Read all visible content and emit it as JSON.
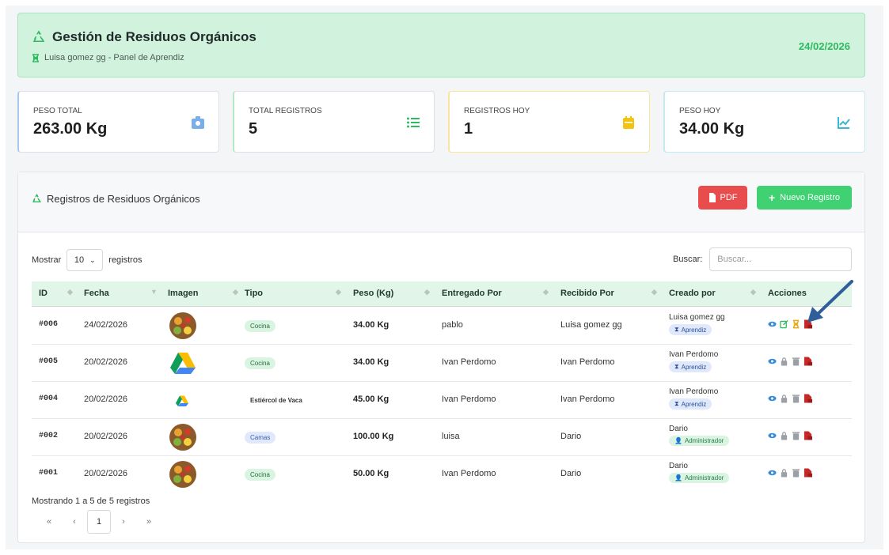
{
  "header": {
    "title": "Gestión de Residuos Orgánicos",
    "subtitle": "Luisa gomez gg - Panel de Aprendiz",
    "date": "24/02/2026"
  },
  "stats": [
    {
      "label": "PESO TOTAL",
      "value": "263.00 Kg",
      "icon": "weight-icon",
      "color": "#4a90e2"
    },
    {
      "label": "TOTAL REGISTROS",
      "value": "5",
      "icon": "list-icon",
      "color": "#2dbb5f"
    },
    {
      "label": "REGISTROS HOY",
      "value": "1",
      "icon": "calendar-icon",
      "color": "#f2c311"
    },
    {
      "label": "PESO HOY",
      "value": "34.00 Kg",
      "icon": "chart-line-icon",
      "color": "#3ab7d4"
    }
  ],
  "panel": {
    "title": "Registros de Residuos Orgánicos",
    "pdf_label": "PDF",
    "new_label": "Nuevo Registro"
  },
  "controls": {
    "show_label": "Mostrar",
    "show_value": "10",
    "show_suffix": "registros",
    "search_label": "Buscar:",
    "search_placeholder": "Buscar..."
  },
  "columns": [
    "ID",
    "Fecha",
    "Imagen",
    "Tipo",
    "Peso (Kg)",
    "Entregado Por",
    "Recibido Por",
    "Creado por",
    "Acciones"
  ],
  "rows": [
    {
      "id": "#006",
      "fecha": "24/02/2026",
      "image": "vegetables-image",
      "tipo": "Cocina",
      "peso": "34.00 Kg",
      "entregado": "pablo",
      "recibido": "Luisa gomez gg",
      "creador": "Luisa gomez gg",
      "rol": "Aprendiz"
    },
    {
      "id": "#005",
      "fecha": "20/02/2026",
      "image": "drive-logo-image",
      "tipo": "Cocina",
      "peso": "34.00 Kg",
      "entregado": "Ivan Perdomo",
      "recibido": "Ivan Perdomo",
      "creador": "Ivan Perdomo",
      "rol": "Aprendiz"
    },
    {
      "id": "#004",
      "fecha": "20/02/2026",
      "image": "drive-logo-small-image",
      "tipo": "Estiércol de Vaca",
      "peso": "45.00 Kg",
      "entregado": "Ivan Perdomo",
      "recibido": "Ivan Perdomo",
      "creador": "Ivan Perdomo",
      "rol": "Aprendiz"
    },
    {
      "id": "#002",
      "fecha": "20/02/2026",
      "image": "vegetables-image",
      "tipo": "Camas",
      "peso": "100.00 Kg",
      "entregado": "luisa",
      "recibido": "Dario",
      "creador": "Dario",
      "rol": "Administrador"
    },
    {
      "id": "#001",
      "fecha": "20/02/2026",
      "image": "vegetables-image",
      "tipo": "Cocina",
      "peso": "50.00 Kg",
      "entregado": "Ivan Perdomo",
      "recibido": "Dario",
      "creador": "Dario",
      "rol": "Administrador"
    }
  ],
  "footer": {
    "info": "Mostrando 1 a 5 de 5 registros",
    "first": "«",
    "prev": "‹",
    "page": "1",
    "next": "›",
    "last": "»"
  }
}
